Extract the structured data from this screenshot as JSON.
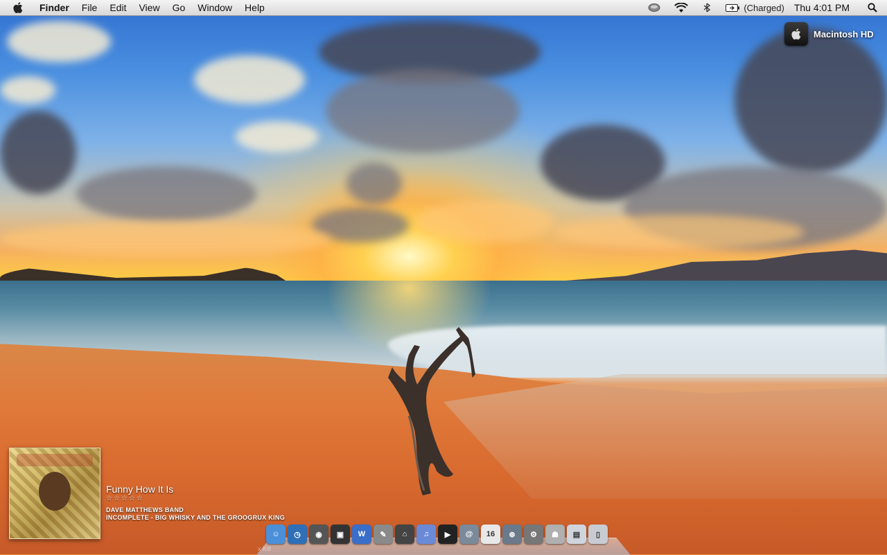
{
  "menubar": {
    "app_name": "Finder",
    "items": [
      "File",
      "Edit",
      "View",
      "Go",
      "Window",
      "Help"
    ],
    "battery_status": "(Charged)",
    "clock": "Thu 4:01 PM"
  },
  "desktop": {
    "hard_drive_label": "Macintosh HD"
  },
  "now_playing": {
    "track": "Funny How It Is",
    "rating": "☆☆☆☆☆",
    "artist": "DAVE MATTHEWS BAND",
    "album": "INCOMPLETE - BIG WHISKY AND THE GROOGRUX KING"
  },
  "dock": {
    "ghost_text": "x Kill",
    "items": [
      {
        "name": "finder-dock-icon",
        "color": "#4a8fd8",
        "glyph": "☺"
      },
      {
        "name": "safari-dock-icon",
        "color": "#2f6fb8",
        "glyph": "◷"
      },
      {
        "name": "camera-dock-icon",
        "color": "#555555",
        "glyph": "◉"
      },
      {
        "name": "preview-dock-icon",
        "color": "#333333",
        "glyph": "▣"
      },
      {
        "name": "word-dock-icon",
        "color": "#3a6ec8",
        "glyph": "W"
      },
      {
        "name": "script-editor-dock-icon",
        "color": "#8a8a8a",
        "glyph": "✎"
      },
      {
        "name": "birdhouse-dock-icon",
        "color": "#444444",
        "glyph": "⌂"
      },
      {
        "name": "itunes-dock-icon",
        "color": "#6a8ad8",
        "glyph": "♫"
      },
      {
        "name": "dvd-player-dock-icon",
        "color": "#222222",
        "glyph": "▶"
      },
      {
        "name": "mail-dock-icon",
        "color": "#7a8a9a",
        "glyph": "@"
      },
      {
        "name": "calendar-dock-icon",
        "color": "#e8e8e8",
        "glyph": "16"
      },
      {
        "name": "trash-recycle-dock-icon",
        "color": "#6a7a8a",
        "glyph": "⊛"
      },
      {
        "name": "system-preferences-dock-icon",
        "color": "#777777",
        "glyph": "⚙"
      },
      {
        "name": "robot-dock-icon",
        "color": "#b0b0b0",
        "glyph": "☗"
      },
      {
        "name": "docs-folder-dock-icon",
        "color": "#d0d4dc",
        "glyph": "▤"
      },
      {
        "name": "trash-dock-icon",
        "color": "#c8ccd2",
        "glyph": "▯"
      }
    ]
  }
}
